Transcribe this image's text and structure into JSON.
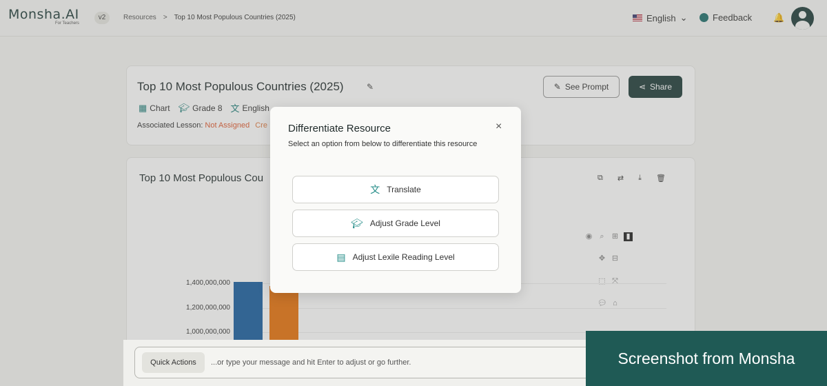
{
  "header": {
    "logo_text": "Monsha.AI",
    "logo_sub": "For Teachers",
    "version": "v2",
    "breadcrumb": {
      "root": "Resources",
      "separator": ">",
      "current": "Top 10 Most Populous Countries (2025)"
    },
    "language": "English",
    "feedback": "Feedback"
  },
  "resource": {
    "title": "Top 10 Most Populous Countries (2025)",
    "tags": {
      "type": "Chart",
      "grade": "Grade 8",
      "language": "English"
    },
    "associated_label": "Associated Lesson:",
    "associated_value": "Not Assigned",
    "associated_action": "Cre",
    "see_prompt": "See Prompt",
    "share": "Share"
  },
  "chart_card": {
    "title": "Top 10 Most Populous Cou"
  },
  "chart_data": {
    "type": "bar",
    "title": "",
    "yticks": [
      "1,400,000,000",
      "1,200,000,000",
      "1,000,000,000"
    ],
    "ylim_visible": [
      1000000000,
      1400000000
    ],
    "series": [
      {
        "values": [
          1410000000
        ],
        "color": "#1a5fa0"
      },
      {
        "values": [
          1380000000
        ],
        "color": "#e8720c"
      }
    ]
  },
  "modal": {
    "title": "Differentiate Resource",
    "subtitle": "Select an option from below to differentiate this resource",
    "options": [
      {
        "label": "Translate",
        "icon": "translate-icon"
      },
      {
        "label": "Adjust Grade Level",
        "icon": "graduation-cap-icon"
      },
      {
        "label": "Adjust Lexile Reading Level",
        "icon": "reading-level-icon"
      }
    ]
  },
  "message_bar": {
    "quick_actions": "Quick Actions",
    "placeholder": "...or type your message and hit Enter to adjust or go further."
  },
  "banner": {
    "text": "Screenshot from Monsha"
  },
  "colors": {
    "brand_dark": "#1f3c3a",
    "accent_teal": "#1f8a85",
    "warning": "#e05a30"
  }
}
